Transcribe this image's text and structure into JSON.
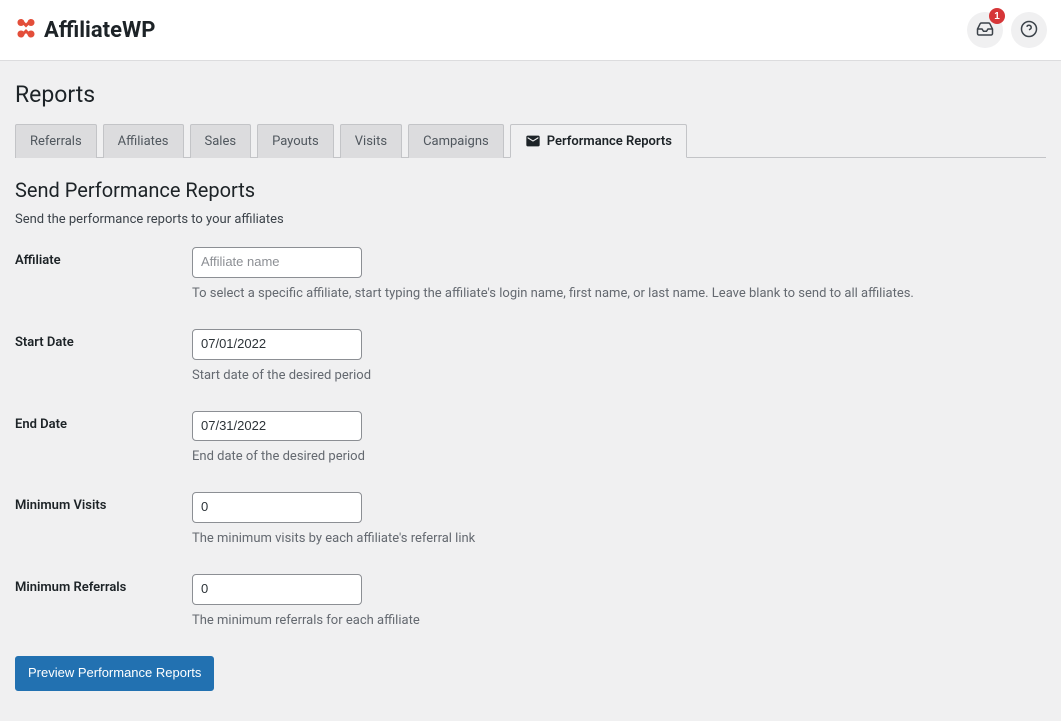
{
  "header": {
    "brand": "AffiliateWP",
    "inbox_badge": "1"
  },
  "page_title": "Reports",
  "tabs": [
    {
      "label": "Referrals"
    },
    {
      "label": "Affiliates"
    },
    {
      "label": "Sales"
    },
    {
      "label": "Payouts"
    },
    {
      "label": "Visits"
    },
    {
      "label": "Campaigns"
    },
    {
      "label": "Performance Reports"
    }
  ],
  "section": {
    "title": "Send Performance Reports",
    "desc": "Send the performance reports to your affiliates"
  },
  "form": {
    "affiliate": {
      "label": "Affiliate",
      "placeholder": "Affiliate name",
      "value": "",
      "help": "To select a specific affiliate, start typing the affiliate's login name, first name, or last name. Leave blank to send to all affiliates."
    },
    "start_date": {
      "label": "Start Date",
      "value": "07/01/2022",
      "help": "Start date of the desired period"
    },
    "end_date": {
      "label": "End Date",
      "value": "07/31/2022",
      "help": "End date of the desired period"
    },
    "min_visits": {
      "label": "Minimum Visits",
      "value": "0",
      "help": "The minimum visits by each affiliate's referral link"
    },
    "min_referrals": {
      "label": "Minimum Referrals",
      "value": "0",
      "help": "The minimum referrals for each affiliate"
    },
    "submit_label": "Preview Performance Reports"
  }
}
